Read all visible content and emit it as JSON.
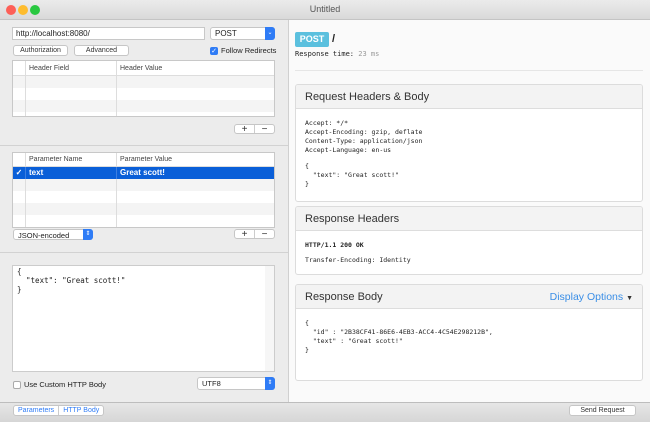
{
  "window": {
    "title": "Untitled"
  },
  "request": {
    "url": "http://localhost:8080/",
    "method": "POST",
    "authorization_label": "Authorization",
    "advanced_label": "Advanced",
    "follow_redirects_label": "Follow Redirects",
    "follow_redirects": true
  },
  "headers_table": {
    "columns": [
      "Header Field",
      "Header Value"
    ],
    "rows": []
  },
  "params_table": {
    "columns": [
      "Parameter Name",
      "Parameter Value"
    ],
    "rows": [
      {
        "checked": true,
        "name": "text",
        "value": "Great scott!"
      }
    ]
  },
  "encoding_select": "JSON-encoded",
  "body_text": "{\n  \"text\": \"Great scott!\"\n}",
  "use_custom_body_label": "Use Custom HTTP Body",
  "charset_select": "UTF8",
  "bottom": {
    "tabs": [
      "Parameters",
      "HTTP Body"
    ],
    "send_label": "Send Request"
  },
  "response": {
    "method_badge": "POST",
    "path": "/",
    "time_label": "Response time:",
    "time_value": "23 ms",
    "badge_color": "#5bc0de",
    "request_panel": {
      "title": "Request Headers & Body",
      "headers": "Accept: */*\nAccept-Encoding: gzip, deflate\nContent-Type: application/json\nAccept-Language: en-us",
      "body": "{\n  \"text\": \"Great scott!\"\n}"
    },
    "headers_panel": {
      "title": "Response Headers",
      "status": "HTTP/1.1 200 OK",
      "headers": "Transfer-Encoding: Identity"
    },
    "body_panel": {
      "title": "Response Body",
      "display_options": "Display Options",
      "body": "{\n  \"id\" : \"2B38CF41-86E6-4EB3-ACC4-4C54E298212B\",\n  \"text\" : \"Great scott!\"\n}"
    }
  }
}
